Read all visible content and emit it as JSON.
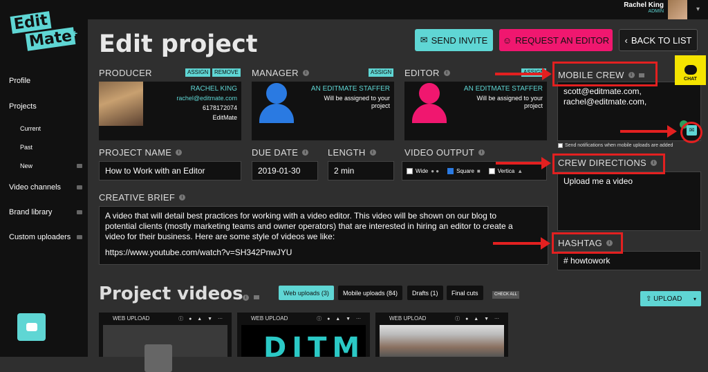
{
  "app": {
    "logo_line1": "Edit",
    "logo_line2": "Mate",
    "logo_plus": "+"
  },
  "user": {
    "name": "Rachel King",
    "role": "ADMIN"
  },
  "sidebar": {
    "items": [
      {
        "label": "Profile"
      },
      {
        "label": "Projects"
      },
      {
        "label": "Current"
      },
      {
        "label": "Past"
      },
      {
        "label": "New"
      },
      {
        "label": "Video channels"
      },
      {
        "label": "Brand library"
      },
      {
        "label": "Custom uploaders"
      }
    ]
  },
  "header": {
    "title": "Edit project",
    "send_invite": "SEND INVITE",
    "request_editor": "REQUEST AN EDITOR",
    "back_to_list": "BACK TO LIST"
  },
  "producer": {
    "label": "PRODUCER",
    "assign": "ASSIGN",
    "remove": "REMOVE",
    "name": "RACHEL KING",
    "email": "rachel@editmate.com",
    "phone": "6178172074",
    "company": "EditMate"
  },
  "manager": {
    "label": "MANAGER",
    "assign": "ASSIGN",
    "name": "AN EDITMATE STAFFER",
    "note1": "Will be assigned to your",
    "note2": "project"
  },
  "editor": {
    "label": "EDITOR",
    "assign": "ASSIGN",
    "name": "AN EDITMATE STAFFER",
    "note1": "Will be assigned to your",
    "note2": "project"
  },
  "mobile_crew": {
    "label": "MOBILE CREW",
    "line1": "scott@editmate.com,",
    "line2": "rachel@editmate.com,",
    "notify": "Send notifications when mobile uploads are added"
  },
  "chat": {
    "label": "CHAT"
  },
  "project_name": {
    "label": "PROJECT NAME",
    "value": "How to Work with an Editor"
  },
  "due_date": {
    "label": "DUE DATE",
    "value": "2019-01-30"
  },
  "length": {
    "label": "LENGTH",
    "value": "2 min"
  },
  "video_output": {
    "label": "VIDEO OUTPUT",
    "wide": "Wide",
    "square": "Square",
    "vertical": "Vertica"
  },
  "crew_directions": {
    "label": "CREW DIRECTIONS",
    "value": "Upload me a video"
  },
  "hashtag": {
    "label": "HASHTAG",
    "value": "# howtowork"
  },
  "creative_brief": {
    "label": "CREATIVE BRIEF",
    "line1": "A video that will detail best practices for working with a video editor. This video will be shown on our blog to",
    "line2": "potential clients (mostly marketing teams and owner operators) that are interested in hiring an editor to create a",
    "line3": "video for their business. Here are some style of videos we like:",
    "line4": "https://www.youtube.com/watch?v=SH342PnwJYU"
  },
  "project_videos": {
    "title": "Project videos",
    "tabs": [
      "Web uploads (3)",
      "Mobile uploads (84)",
      "Drafts (1)",
      "Final cuts"
    ],
    "check_all": "CHECK ALL",
    "upload": "UPLOAD",
    "thumbs": [
      {
        "label": "WEB UPLOAD"
      },
      {
        "label": "WEB UPLOAD"
      },
      {
        "label": "WEB UPLOAD"
      }
    ],
    "thumb2_text": "DITM"
  },
  "colors": {
    "accent": "#5fd6d4",
    "pink": "#f0176f",
    "blue": "#2a7ae2",
    "annotation": "#e32020",
    "chat": "#f5e400"
  }
}
